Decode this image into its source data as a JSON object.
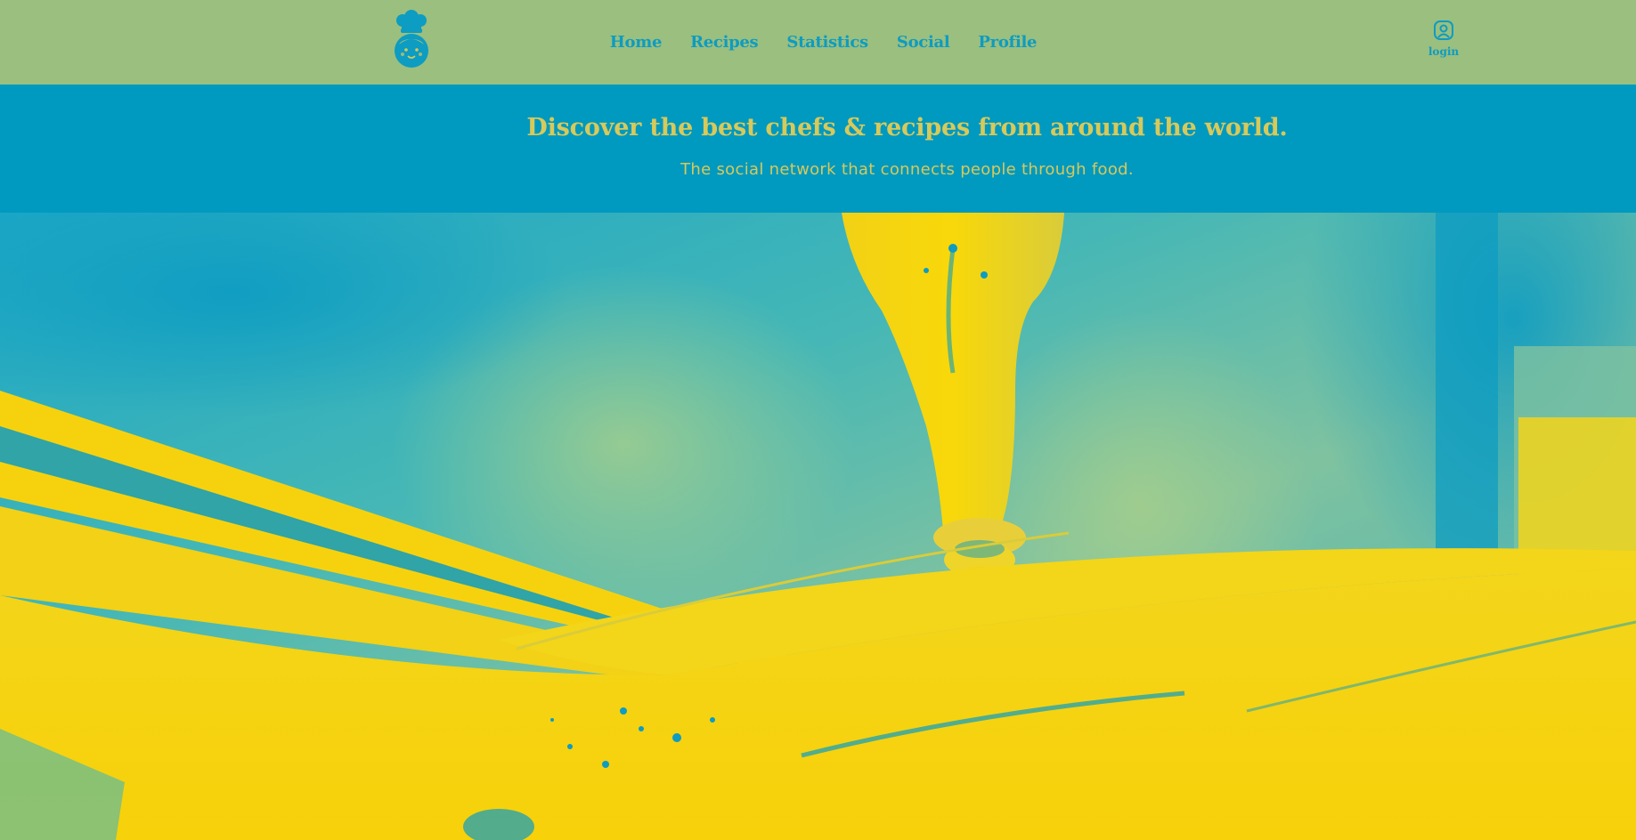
{
  "brand": {
    "logo_icon": "chef-face-icon"
  },
  "nav": {
    "items": [
      {
        "label": "Home"
      },
      {
        "label": "Recipes"
      },
      {
        "label": "Statistics"
      },
      {
        "label": "Social"
      },
      {
        "label": "Profile"
      }
    ]
  },
  "account": {
    "login_label": "login",
    "login_icon": "user-icon"
  },
  "hero": {
    "title": "Discover the best chefs & recipes from around the world.",
    "subtitle": "The social network that connects people through food.",
    "image_description_icon": "oil-pouring-photo"
  },
  "colors": {
    "navbar_bg": "#9bbf7e",
    "accent_blue": "#0d9cc2",
    "hero_band_bg": "#0099c0",
    "hero_text": "#d7c95a",
    "photo_yellow": "#f6d20e",
    "photo_teal": "#3fb6b6"
  }
}
